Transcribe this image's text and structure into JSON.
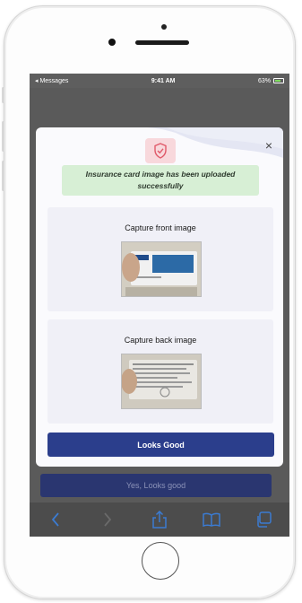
{
  "status_bar": {
    "back_app": "◂ Messages",
    "time": "9:41 AM",
    "battery": "63%"
  },
  "modal": {
    "close_label": "×",
    "toast_line1": "Insurance card image has been uploaded",
    "toast_line2": "successfully",
    "front_card": {
      "title": "Capture front image"
    },
    "back_card": {
      "title": "Capture back image"
    },
    "confirm_button": "Looks Good"
  },
  "background_button": "Yes, Looks good",
  "toolbar": {
    "icons": [
      "chevron-left-icon",
      "chevron-right-icon",
      "share-icon",
      "bookmarks-icon",
      "tabs-icon"
    ]
  },
  "colors": {
    "primary_button": "#2b3e8c",
    "toast_bg": "#d7efd5",
    "shield_bg": "#f8d8dc",
    "card_bg": "#f0f0f7"
  }
}
